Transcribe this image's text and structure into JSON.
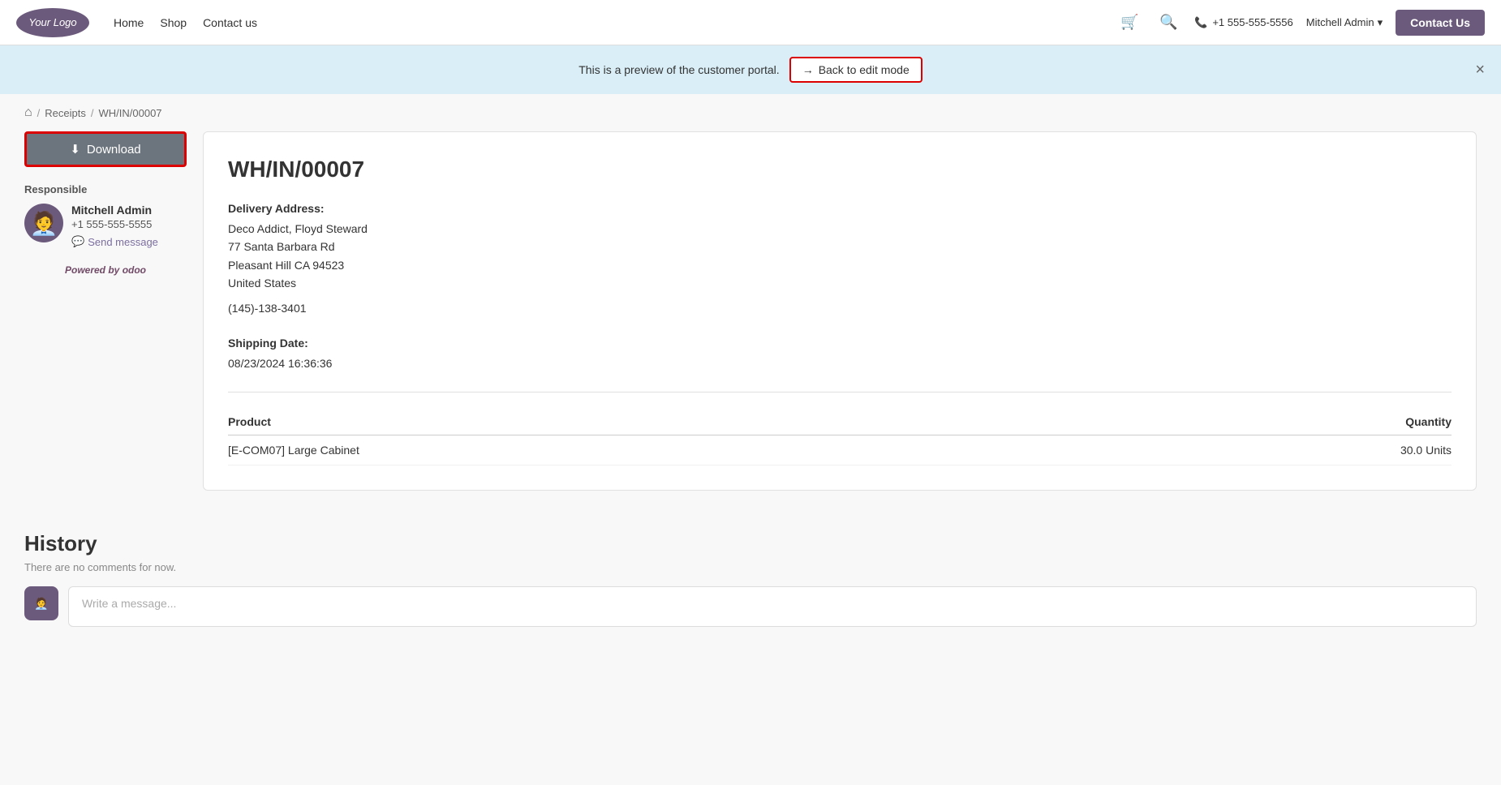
{
  "navbar": {
    "logo_text": "Your Logo",
    "links": [
      "Home",
      "Shop",
      "Contact us"
    ],
    "phone": "+1 555-555-5556",
    "user": "Mitchell Admin",
    "contact_us_label": "Contact Us"
  },
  "preview_banner": {
    "text": "This is a preview of the customer portal.",
    "back_to_edit_label": "Back to edit mode",
    "back_arrow": "→"
  },
  "breadcrumb": {
    "home_icon": "⌂",
    "sep": "/",
    "receipts_label": "Receipts",
    "current": "WH/IN/00007"
  },
  "sidebar": {
    "download_label": "Download",
    "download_icon": "⬇",
    "responsible_label": "Responsible",
    "responsible_name": "Mitchell Admin",
    "responsible_phone": "+1 555-555-5555",
    "send_message_label": "Send message",
    "powered_by_label": "Powered by",
    "powered_by_brand": "odoo"
  },
  "receipt": {
    "title": "WH/IN/00007",
    "delivery_address_label": "Delivery Address:",
    "delivery_name": "Deco Addict, Floyd Steward",
    "delivery_street": "77 Santa Barbara Rd",
    "delivery_city": "Pleasant Hill CA 94523",
    "delivery_country": "United States",
    "delivery_phone": "(145)-138-3401",
    "shipping_date_label": "Shipping Date:",
    "shipping_date": "08/23/2024 16:36:36",
    "table": {
      "col_product": "Product",
      "col_quantity": "Quantity",
      "rows": [
        {
          "product": "[E-COM07] Large Cabinet",
          "quantity": "30.0 Units"
        }
      ]
    }
  },
  "history": {
    "title": "History",
    "empty_message": "There are no comments for now.",
    "message_placeholder": "Write a message..."
  }
}
